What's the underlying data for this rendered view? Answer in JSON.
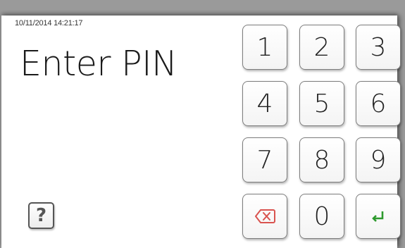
{
  "status": {
    "datetime": "10/11/2014 14:21:17"
  },
  "title": "Enter PIN",
  "help": {
    "label": "?"
  },
  "keypad": {
    "keys": [
      "1",
      "2",
      "3",
      "4",
      "5",
      "6",
      "7",
      "8",
      "9",
      "",
      "0",
      ""
    ],
    "backspace_icon": "backspace-icon",
    "enter_icon": "enter-icon",
    "backspace_color": "#d9534f",
    "enter_color": "#2e9a2e"
  }
}
